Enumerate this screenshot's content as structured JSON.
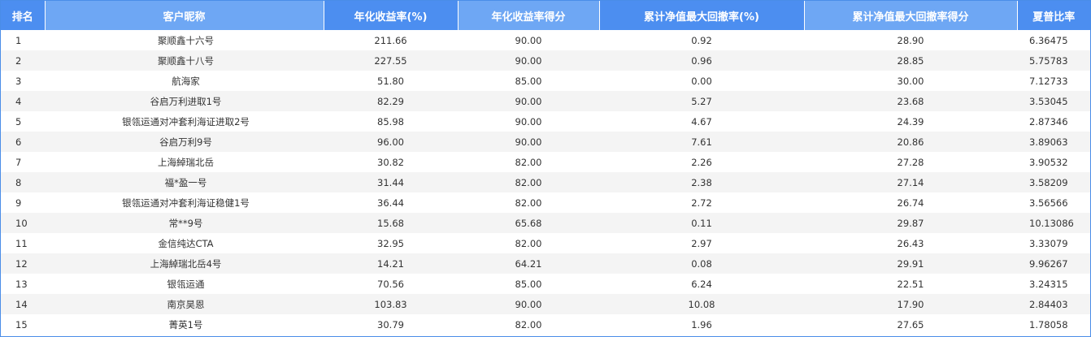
{
  "table": {
    "columns": [
      {
        "label": "排名"
      },
      {
        "label": "客户昵称"
      },
      {
        "label": "年化收益率(%)"
      },
      {
        "label": "年化收益率得分"
      },
      {
        "label": "累计净值最大回撤率(%)"
      },
      {
        "label": "累计净值最大回撤率得分"
      },
      {
        "label": "夏普比率"
      }
    ],
    "rows": [
      {
        "rank": "1",
        "name": "聚顺鑫十六号",
        "annual_return": "211.66",
        "annual_return_score": "90.00",
        "max_drawdown": "0.92",
        "max_drawdown_score": "28.90",
        "sharpe": "6.36475"
      },
      {
        "rank": "2",
        "name": "聚顺鑫十八号",
        "annual_return": "227.55",
        "annual_return_score": "90.00",
        "max_drawdown": "0.96",
        "max_drawdown_score": "28.85",
        "sharpe": "5.75783"
      },
      {
        "rank": "3",
        "name": "航海家",
        "annual_return": "51.80",
        "annual_return_score": "85.00",
        "max_drawdown": "0.00",
        "max_drawdown_score": "30.00",
        "sharpe": "7.12733"
      },
      {
        "rank": "4",
        "name": "谷启万利进取1号",
        "annual_return": "82.29",
        "annual_return_score": "90.00",
        "max_drawdown": "5.27",
        "max_drawdown_score": "23.68",
        "sharpe": "3.53045"
      },
      {
        "rank": "5",
        "name": "银瓴运通对冲套利海证进取2号",
        "annual_return": "85.98",
        "annual_return_score": "90.00",
        "max_drawdown": "4.67",
        "max_drawdown_score": "24.39",
        "sharpe": "2.87346"
      },
      {
        "rank": "6",
        "name": "谷启万利9号",
        "annual_return": "96.00",
        "annual_return_score": "90.00",
        "max_drawdown": "7.61",
        "max_drawdown_score": "20.86",
        "sharpe": "3.89063"
      },
      {
        "rank": "7",
        "name": "上海綽瑞北岳",
        "annual_return": "30.82",
        "annual_return_score": "82.00",
        "max_drawdown": "2.26",
        "max_drawdown_score": "27.28",
        "sharpe": "3.90532"
      },
      {
        "rank": "8",
        "name": "福*盈一号",
        "annual_return": "31.44",
        "annual_return_score": "82.00",
        "max_drawdown": "2.38",
        "max_drawdown_score": "27.14",
        "sharpe": "3.58209"
      },
      {
        "rank": "9",
        "name": "银瓴运通对冲套利海证稳健1号",
        "annual_return": "36.44",
        "annual_return_score": "82.00",
        "max_drawdown": "2.72",
        "max_drawdown_score": "26.74",
        "sharpe": "3.56566"
      },
      {
        "rank": "10",
        "name": "常**9号",
        "annual_return": "15.68",
        "annual_return_score": "65.68",
        "max_drawdown": "0.11",
        "max_drawdown_score": "29.87",
        "sharpe": "10.13086"
      },
      {
        "rank": "11",
        "name": "金信纯达CTA",
        "annual_return": "32.95",
        "annual_return_score": "82.00",
        "max_drawdown": "2.97",
        "max_drawdown_score": "26.43",
        "sharpe": "3.33079"
      },
      {
        "rank": "12",
        "name": "上海綽瑞北岳4号",
        "annual_return": "14.21",
        "annual_return_score": "64.21",
        "max_drawdown": "0.08",
        "max_drawdown_score": "29.91",
        "sharpe": "9.96267"
      },
      {
        "rank": "13",
        "name": "银瓴运通",
        "annual_return": "70.56",
        "annual_return_score": "85.00",
        "max_drawdown": "6.24",
        "max_drawdown_score": "22.51",
        "sharpe": "3.24315"
      },
      {
        "rank": "14",
        "name": "南京昊恩",
        "annual_return": "103.83",
        "annual_return_score": "90.00",
        "max_drawdown": "10.08",
        "max_drawdown_score": "17.90",
        "sharpe": "2.84403"
      },
      {
        "rank": "15",
        "name": "菁英1号",
        "annual_return": "30.79",
        "annual_return_score": "82.00",
        "max_drawdown": "1.96",
        "max_drawdown_score": "27.65",
        "sharpe": "1.78058"
      }
    ]
  }
}
